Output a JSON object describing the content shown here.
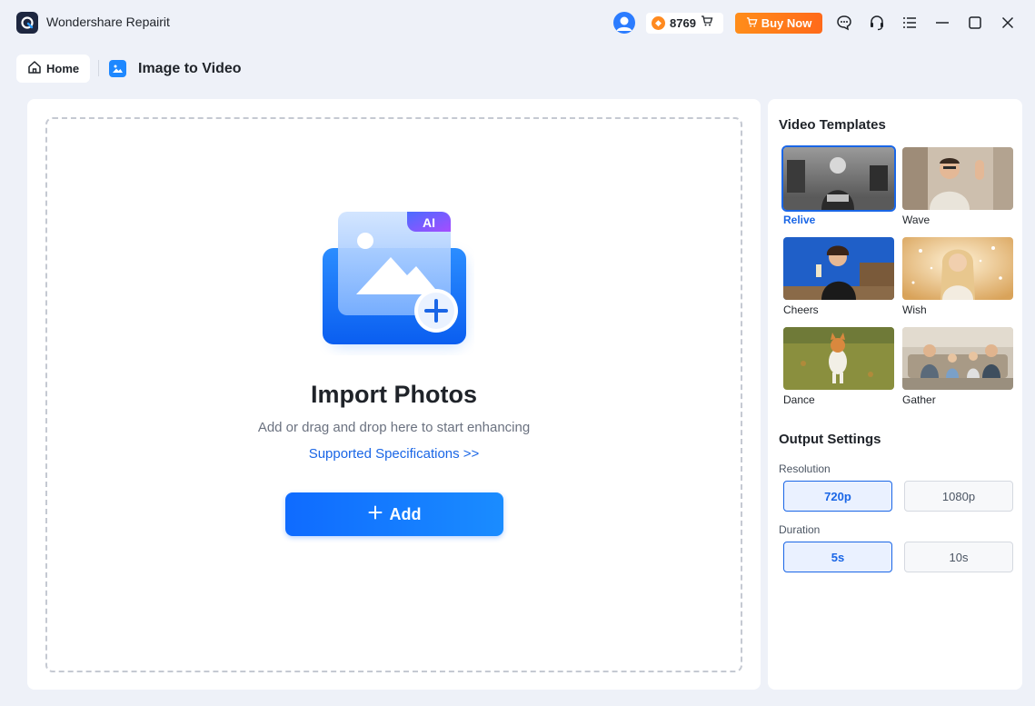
{
  "app": {
    "title": "Wondershare Repairit",
    "credits": "8769",
    "buy_label": "Buy Now",
    "accent": "#1a66e6"
  },
  "breadcrumb": {
    "home_label": "Home",
    "current": "Image to Video"
  },
  "main": {
    "ai_badge": "AI",
    "import_title": "Import Photos",
    "import_subtitle": "Add or drag and drop here to start enhancing",
    "spec_link": "Supported Specifications >>",
    "add_label": "Add"
  },
  "sidebar": {
    "templates_title": "Video Templates",
    "templates": [
      {
        "label": "Relive",
        "selected": true
      },
      {
        "label": "Wave",
        "selected": false
      },
      {
        "label": "Cheers",
        "selected": false
      },
      {
        "label": "Wish",
        "selected": false
      },
      {
        "label": "Dance",
        "selected": false
      },
      {
        "label": "Gather",
        "selected": false
      }
    ],
    "output_title": "Output Settings",
    "resolution_label": "Resolution",
    "resolution_options": [
      "720p",
      "1080p"
    ],
    "resolution_selected": "720p",
    "duration_label": "Duration",
    "duration_options": [
      "5s",
      "10s"
    ],
    "duration_selected": "5s"
  }
}
